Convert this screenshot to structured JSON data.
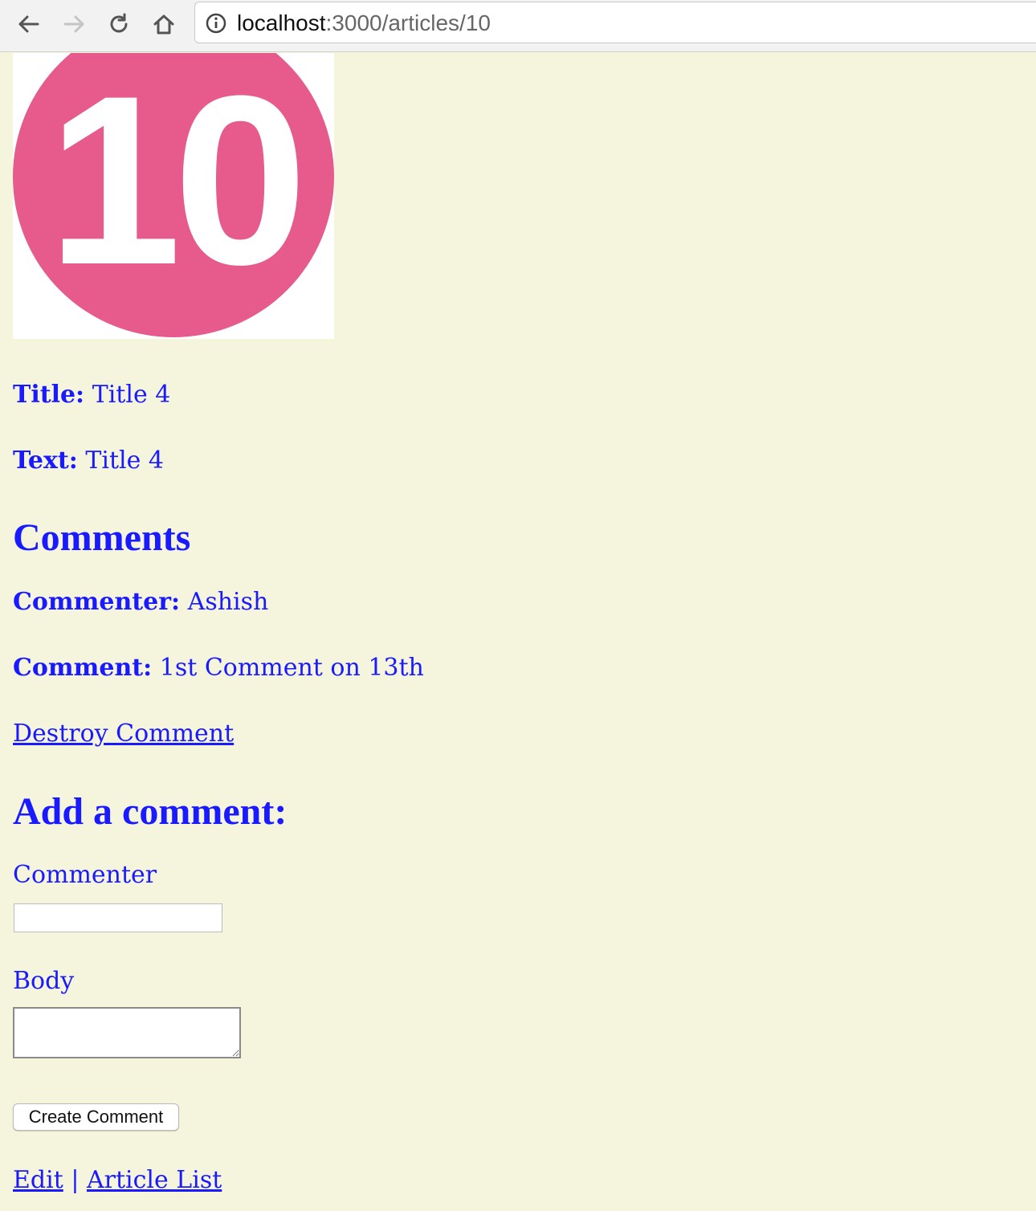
{
  "browser": {
    "url_host": "localhost",
    "url_rest": ":3000/articles/10"
  },
  "article": {
    "image_number": "10",
    "title_label": "Title:",
    "title_value": "Title 4",
    "text_label": "Text:",
    "text_value": "Title 4"
  },
  "comments": {
    "heading": "Comments",
    "items": [
      {
        "commenter_label": "Commenter:",
        "commenter_value": "Ashish",
        "comment_label": "Comment:",
        "comment_value": "1st Comment on 13th",
        "destroy_link": "Destroy Comment"
      }
    ]
  },
  "add_comment": {
    "heading": "Add a comment:",
    "commenter_label": "Commenter",
    "commenter_value": "",
    "body_label": "Body",
    "body_value": "",
    "submit_label": "Create Comment"
  },
  "footer": {
    "edit_link": "Edit",
    "separator": "|",
    "list_link": "Article List"
  },
  "colors": {
    "page_background": "#f5f4dd",
    "text": "#1a1aff",
    "badge": "#e65a8c"
  }
}
